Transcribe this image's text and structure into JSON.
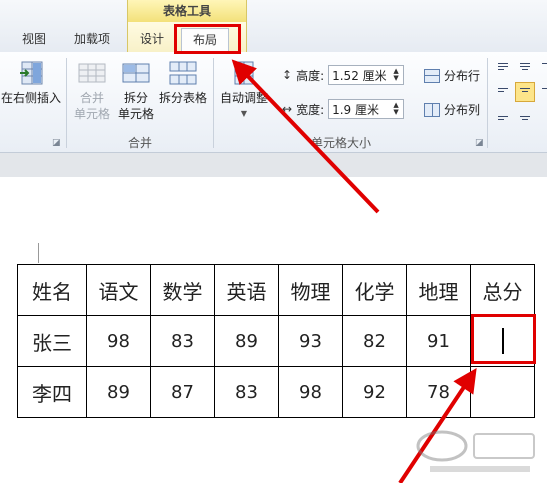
{
  "ribbon": {
    "context_title": "表格工具",
    "tabs": [
      {
        "label": "视图"
      },
      {
        "label": "加载项"
      },
      {
        "label": "设计"
      },
      {
        "label": "布局",
        "active": true
      }
    ],
    "insert_right_label": "在右侧插入",
    "merge": {
      "merge_cells_label_1": "合并",
      "merge_cells_label_2": "单元格",
      "split_cells_label_1": "拆分",
      "split_cells_label_2": "单元格",
      "split_table_label": "拆分表格",
      "group_label": "合并"
    },
    "cell_size": {
      "autofit_label": "自动调整",
      "height_label": "高度:",
      "height_value": "1.52 厘米",
      "width_label": "宽度:",
      "width_value": "1.9 厘米",
      "distribute_rows_label": "分布行",
      "distribute_cols_label": "分布列",
      "group_label": "单元格大小"
    }
  },
  "table": {
    "headers": [
      "姓名",
      "语文",
      "数学",
      "英语",
      "物理",
      "化学",
      "地理",
      "总分"
    ],
    "rows": [
      {
        "name": "张三",
        "scores": [
          "98",
          "83",
          "89",
          "93",
          "82",
          "91"
        ],
        "total": ""
      },
      {
        "name": "李四",
        "scores": [
          "89",
          "87",
          "83",
          "98",
          "92",
          "78"
        ],
        "total": ""
      }
    ]
  },
  "colors": {
    "annotation": "#e00000",
    "context_tab": "#f3e17a"
  }
}
